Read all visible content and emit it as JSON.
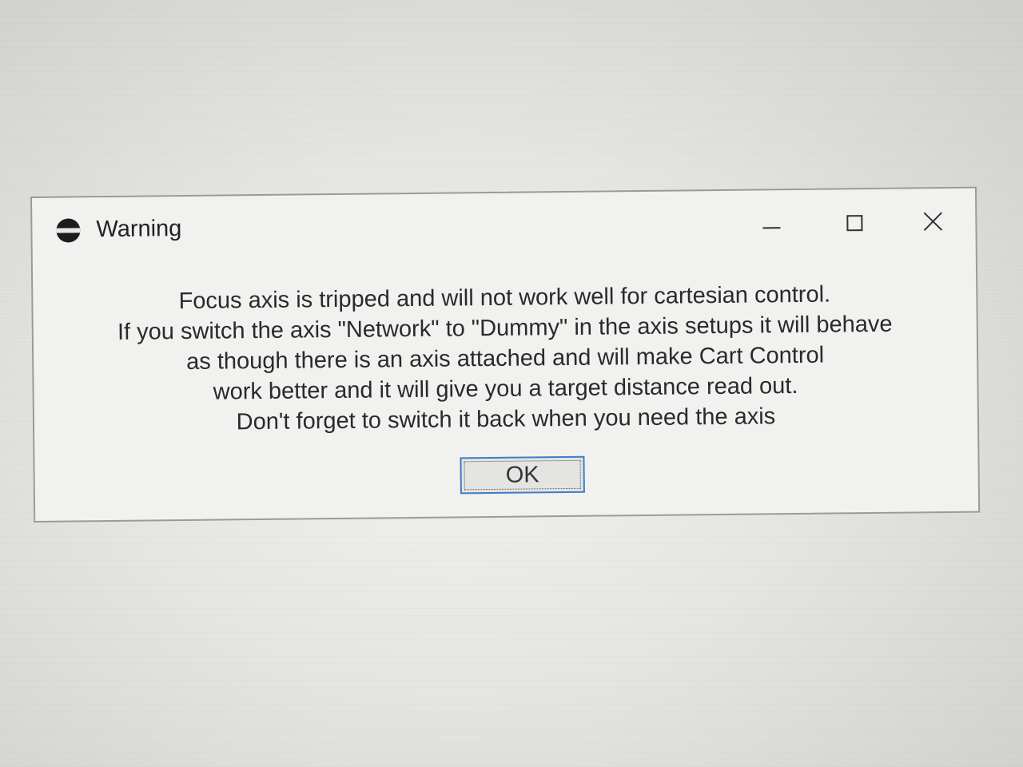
{
  "window": {
    "title": "Warning",
    "controls": {
      "minimize_icon": "minimize-icon",
      "maximize_icon": "maximize-icon",
      "close_icon": "close-icon"
    }
  },
  "message": {
    "lines": [
      "Focus axis is tripped and will not work well for cartesian control.",
      "If you switch the axis \"Network\" to \"Dummy\" in the axis setups it will behave",
      "as though there is an axis attached and will make Cart Control",
      "work better and it will give you a target distance read out.",
      "Don't forget to switch it back when you need the axis"
    ]
  },
  "buttons": {
    "ok_label": "OK"
  },
  "colors": {
    "focus_border": "#3a7fc8",
    "dialog_background": "#f1f1ef"
  }
}
